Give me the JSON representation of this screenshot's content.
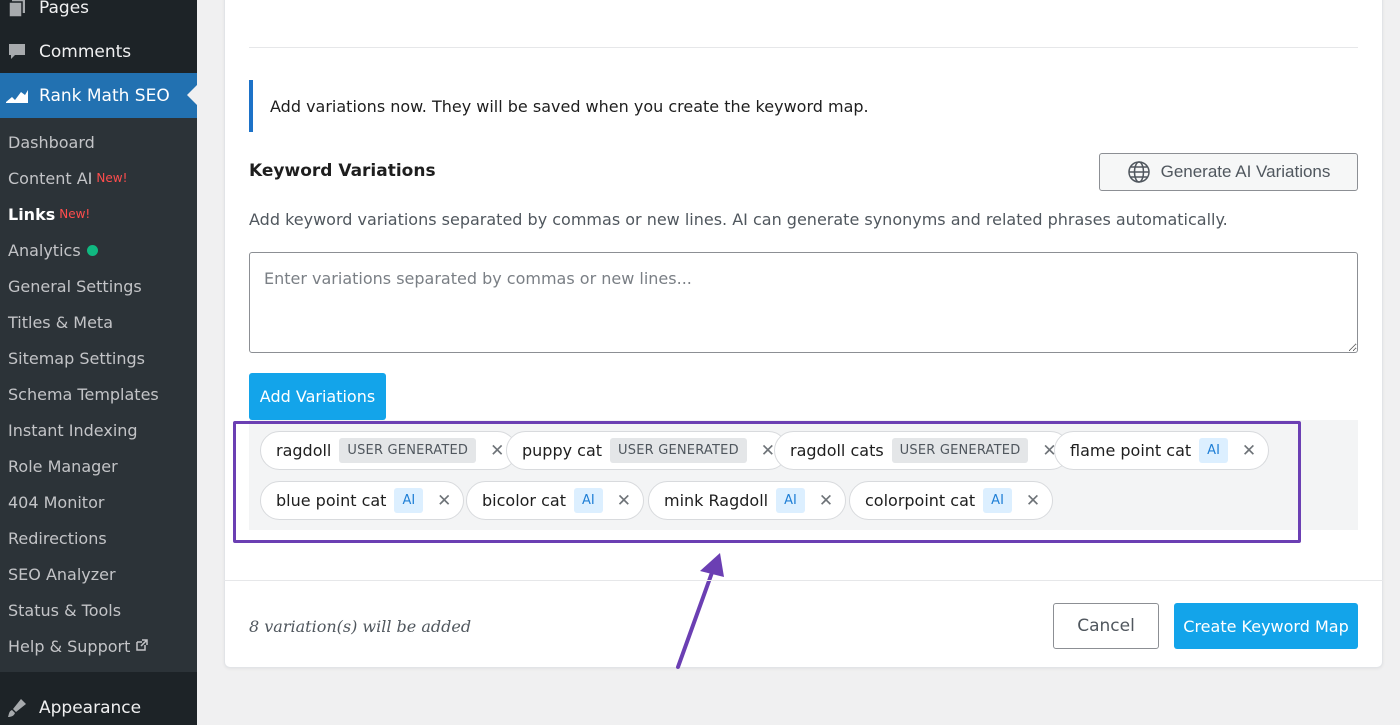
{
  "sidebar": {
    "top_items": [
      {
        "label": "Pages",
        "icon": "pages-icon"
      },
      {
        "label": "Comments",
        "icon": "comment-icon"
      },
      {
        "label": "Rank Math SEO",
        "icon": "rank-math-icon"
      }
    ],
    "sub_items": [
      {
        "label": "Dashboard"
      },
      {
        "label": "Content AI",
        "badge": "New!"
      },
      {
        "label": "Links",
        "badge": "New!"
      },
      {
        "label": "Analytics"
      },
      {
        "label": "General Settings"
      },
      {
        "label": "Titles & Meta"
      },
      {
        "label": "Sitemap Settings"
      },
      {
        "label": "Schema Templates"
      },
      {
        "label": "Instant Indexing"
      },
      {
        "label": "Role Manager"
      },
      {
        "label": "404 Monitor"
      },
      {
        "label": "Redirections"
      },
      {
        "label": "SEO Analyzer"
      },
      {
        "label": "Status & Tools"
      },
      {
        "label": "Help & Support"
      }
    ],
    "bottom_item": {
      "label": "Appearance",
      "icon": "brush-icon"
    }
  },
  "notice": "Add variations now. They will be saved when you create the keyword map.",
  "section": {
    "title": "Keyword Variations",
    "generate_label": "Generate AI Variations",
    "description": "Add keyword variations separated by commas or new lines. AI can generate synonyms and related phrases automatically.",
    "placeholder": "Enter variations separated by commas or new lines...",
    "add_label": "Add Variations"
  },
  "tags": [
    {
      "text": "ragdoll",
      "badge": "USER GENERATED",
      "kind": "ug"
    },
    {
      "text": "puppy cat",
      "badge": "USER GENERATED",
      "kind": "ug"
    },
    {
      "text": "ragdoll cats",
      "badge": "USER GENERATED",
      "kind": "ug"
    },
    {
      "text": "flame point cat",
      "badge": "AI",
      "kind": "ai"
    },
    {
      "text": "blue point cat",
      "badge": "AI",
      "kind": "ai"
    },
    {
      "text": "bicolor cat",
      "badge": "AI",
      "kind": "ai"
    },
    {
      "text": "mink Ragdoll",
      "badge": "AI",
      "kind": "ai"
    },
    {
      "text": "colorpoint cat",
      "badge": "AI",
      "kind": "ai"
    }
  ],
  "footer": {
    "note": "8 variation(s) will be added",
    "cancel_label": "Cancel",
    "create_label": "Create Keyword Map"
  },
  "colors": {
    "sidebar_bg": "#1d2327",
    "active_menu": "#2271b1",
    "primary_button": "#13a4ea",
    "highlight_box": "#6b3fb3",
    "ai_badge_bg": "#dcefff"
  }
}
